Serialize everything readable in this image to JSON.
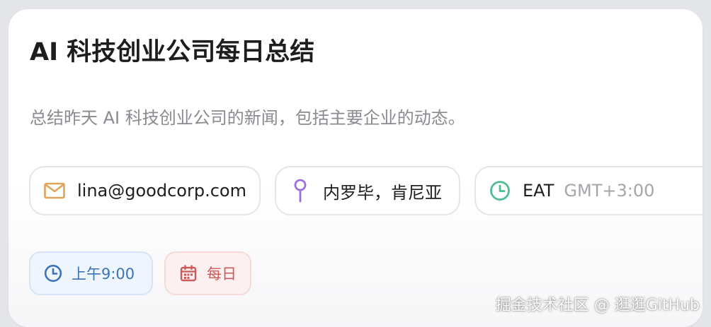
{
  "card": {
    "title": "AI 科技创业公司每日总结",
    "description": "总结昨天 AI 科技创业公司的新闻，包括主要企业的动态。"
  },
  "contact_chips": {
    "email": {
      "icon": "mail-icon",
      "text": "lina@goodcorp.com"
    },
    "location": {
      "icon": "map-pin-icon",
      "text": "内罗毕，肯尼亚"
    },
    "timezone": {
      "icon": "clock-icon",
      "text": "EAT",
      "offset": "GMT+3:00"
    }
  },
  "schedule_tags": {
    "time": {
      "icon": "clock-icon",
      "text": "上午9:00"
    },
    "frequency": {
      "icon": "calendar-icon",
      "text": "每日"
    }
  },
  "watermark": "掘金技术社区 @ 逛逛GitHub",
  "colors": {
    "mail_icon": "#e0a35a",
    "pin_icon": "#9b6fd6",
    "clock_icon": "#4fbf93",
    "time_tag": "#3c73b8",
    "frequency_tag": "#cc5a5a"
  }
}
